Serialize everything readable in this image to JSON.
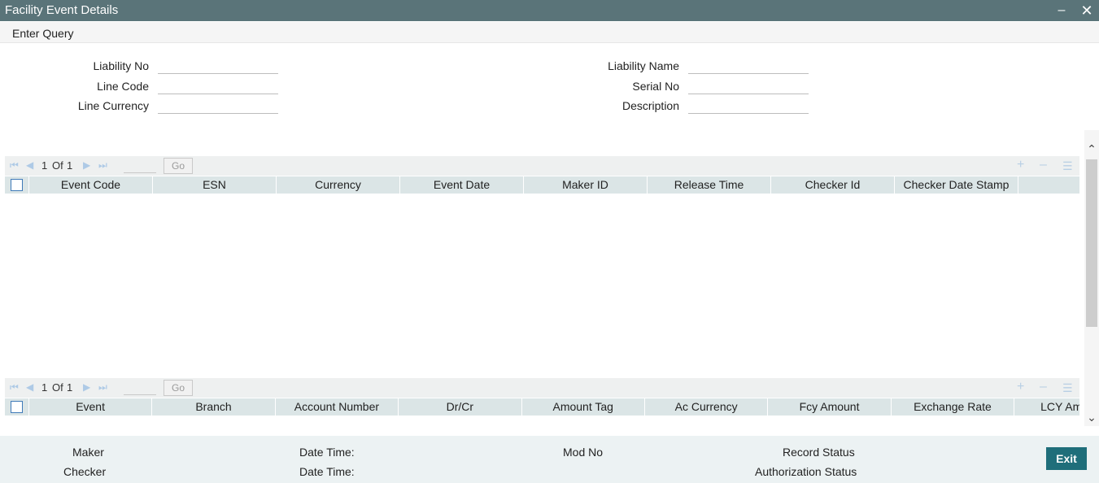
{
  "window": {
    "title": "Facility Event Details",
    "minimize": "–",
    "close": "✕"
  },
  "menu": {
    "enter_query": "Enter Query"
  },
  "form": {
    "liability_no": {
      "label": "Liability No",
      "value": ""
    },
    "line_code": {
      "label": "Line Code",
      "value": ""
    },
    "line_currency": {
      "label": "Line Currency",
      "value": ""
    },
    "liability_name": {
      "label": "Liability Name",
      "value": ""
    },
    "serial_no": {
      "label": "Serial No",
      "value": ""
    },
    "description": {
      "label": "Description",
      "value": ""
    }
  },
  "grid1": {
    "page_current": "1",
    "of_label": "Of",
    "page_total": "1",
    "go_label": "Go",
    "columns": [
      "Event Code",
      "ESN",
      "Currency",
      "Event Date",
      "Maker ID",
      "Release Time",
      "Checker Id",
      "Checker Date Stamp"
    ]
  },
  "grid2": {
    "page_current": "1",
    "of_label": "Of",
    "page_total": "1",
    "go_label": "Go",
    "columns": [
      "Event",
      "Branch",
      "Account Number",
      "Dr/Cr",
      "Amount Tag",
      "Ac Currency",
      "Fcy Amount",
      "Exchange Rate",
      "LCY Am"
    ]
  },
  "footer": {
    "maker": "Maker",
    "checker": "Checker",
    "date_time_1": "Date Time:",
    "date_time_2": "Date Time:",
    "mod_no": "Mod No",
    "record_status": "Record Status",
    "authorization_status": "Authorization Status",
    "exit": "Exit"
  },
  "icons": {
    "first": "first-page-icon",
    "prev": "prev-page-icon",
    "next": "next-page-icon",
    "last": "last-page-icon",
    "add": "plus-icon",
    "remove": "minus-icon",
    "settings": "list-settings-icon"
  },
  "colors": {
    "titlebar": "#5a7479",
    "header": "#dbe5e6",
    "exit_button": "#1f6e7a"
  }
}
